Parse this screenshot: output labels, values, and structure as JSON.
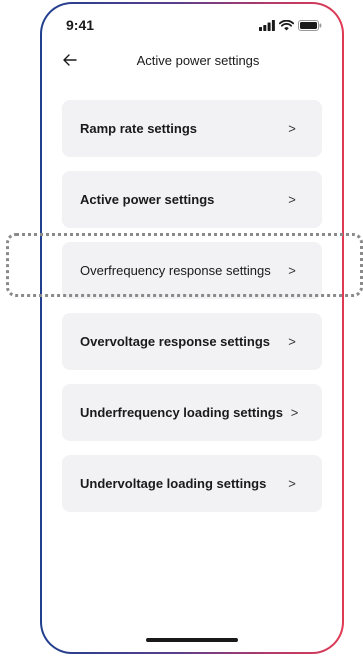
{
  "status_bar": {
    "time": "9:41",
    "icons": [
      "signal-icon",
      "wifi-icon",
      "battery-icon"
    ]
  },
  "header": {
    "back_icon": "arrow-left-icon",
    "title": "Active power settings"
  },
  "menu": {
    "items": [
      {
        "label": "Ramp rate settings",
        "chevron": ">"
      },
      {
        "label": "Active power settings",
        "chevron": ">"
      },
      {
        "label": "Overfrequency response settings",
        "chevron": ">",
        "highlighted": true
      },
      {
        "label": "Overvoltage response settings",
        "chevron": ">"
      },
      {
        "label": "Underfrequency loading settings",
        "chevron": ">"
      },
      {
        "label": "Undervoltage loading settings",
        "chevron": ">"
      }
    ]
  },
  "colors": {
    "frame_gradient_start": "#1f3f8f",
    "frame_gradient_end": "#e03a53",
    "item_background": "#f2f2f4",
    "text": "#1a1a1a",
    "highlight_outline": "#8a8a8a"
  }
}
